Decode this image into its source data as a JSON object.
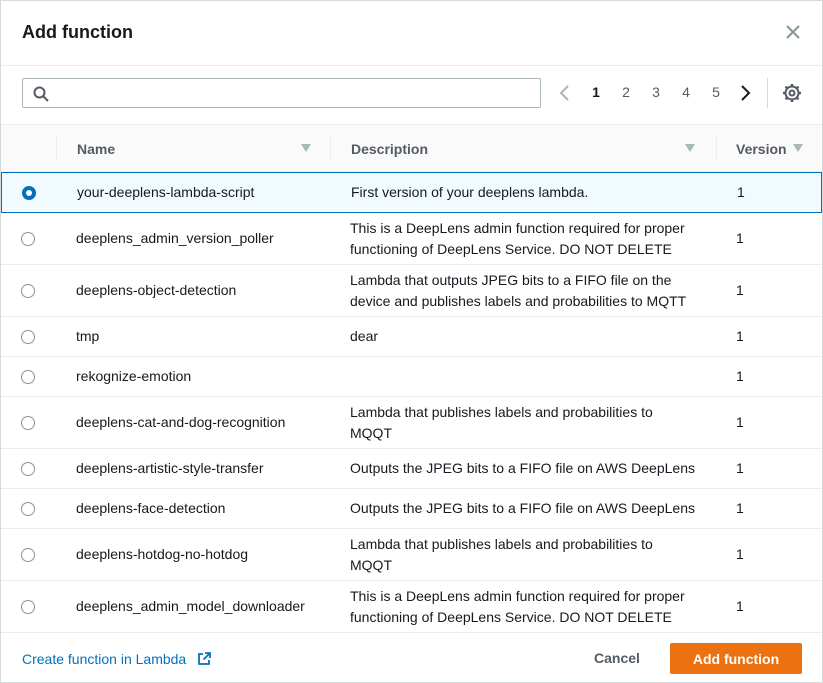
{
  "modal": {
    "title": "Add function"
  },
  "search": {
    "placeholder": "",
    "value": ""
  },
  "pagination": {
    "pages": [
      "1",
      "2",
      "3",
      "4",
      "5"
    ],
    "current": "1"
  },
  "table": {
    "columns": [
      "Name",
      "Description",
      "Version"
    ],
    "rows": [
      {
        "name": "your-deeplens-lambda-script",
        "description": [
          "First version of your deeplens lambda."
        ],
        "version": "1",
        "selected": true
      },
      {
        "name": "deeplens_admin_version_poller",
        "description": [
          "This is a DeepLens admin function required for proper",
          "functioning of DeepLens Service. DO NOT DELETE"
        ],
        "version": "1",
        "selected": false
      },
      {
        "name": "deeplens-object-detection",
        "description": [
          "Lambda that outputs JPEG bits to a FIFO file on the",
          "device and publishes labels and probabilities to MQTT"
        ],
        "version": "1",
        "selected": false
      },
      {
        "name": "tmp",
        "description": [
          "dear"
        ],
        "version": "1",
        "selected": false
      },
      {
        "name": "rekognize-emotion",
        "description": [
          ""
        ],
        "version": "1",
        "selected": false
      },
      {
        "name": "deeplens-cat-and-dog-recognition",
        "description": [
          "Lambda that publishes labels and probabilities to",
          "MQQT"
        ],
        "version": "1",
        "selected": false
      },
      {
        "name": "deeplens-artistic-style-transfer",
        "description": [
          "Outputs the JPEG bits to a FIFO file on AWS DeepLens"
        ],
        "version": "1",
        "selected": false
      },
      {
        "name": "deeplens-face-detection",
        "description": [
          "Outputs the JPEG bits to a FIFO file on AWS DeepLens"
        ],
        "version": "1",
        "selected": false
      },
      {
        "name": "deeplens-hotdog-no-hotdog",
        "description": [
          "Lambda that publishes labels and probabilities to",
          "MQQT"
        ],
        "version": "1",
        "selected": false
      },
      {
        "name": "deeplens_admin_model_downloader",
        "description": [
          "This is a DeepLens admin function required for proper",
          "functioning of DeepLens Service. DO NOT DELETE"
        ],
        "version": "1",
        "selected": false
      }
    ]
  },
  "footer": {
    "create_link": "Create function in Lambda",
    "cancel_label": "Cancel",
    "add_label": "Add function"
  },
  "colors": {
    "accent": "#0073bb",
    "primary_button": "#ec7211",
    "border": "#eaeded"
  }
}
